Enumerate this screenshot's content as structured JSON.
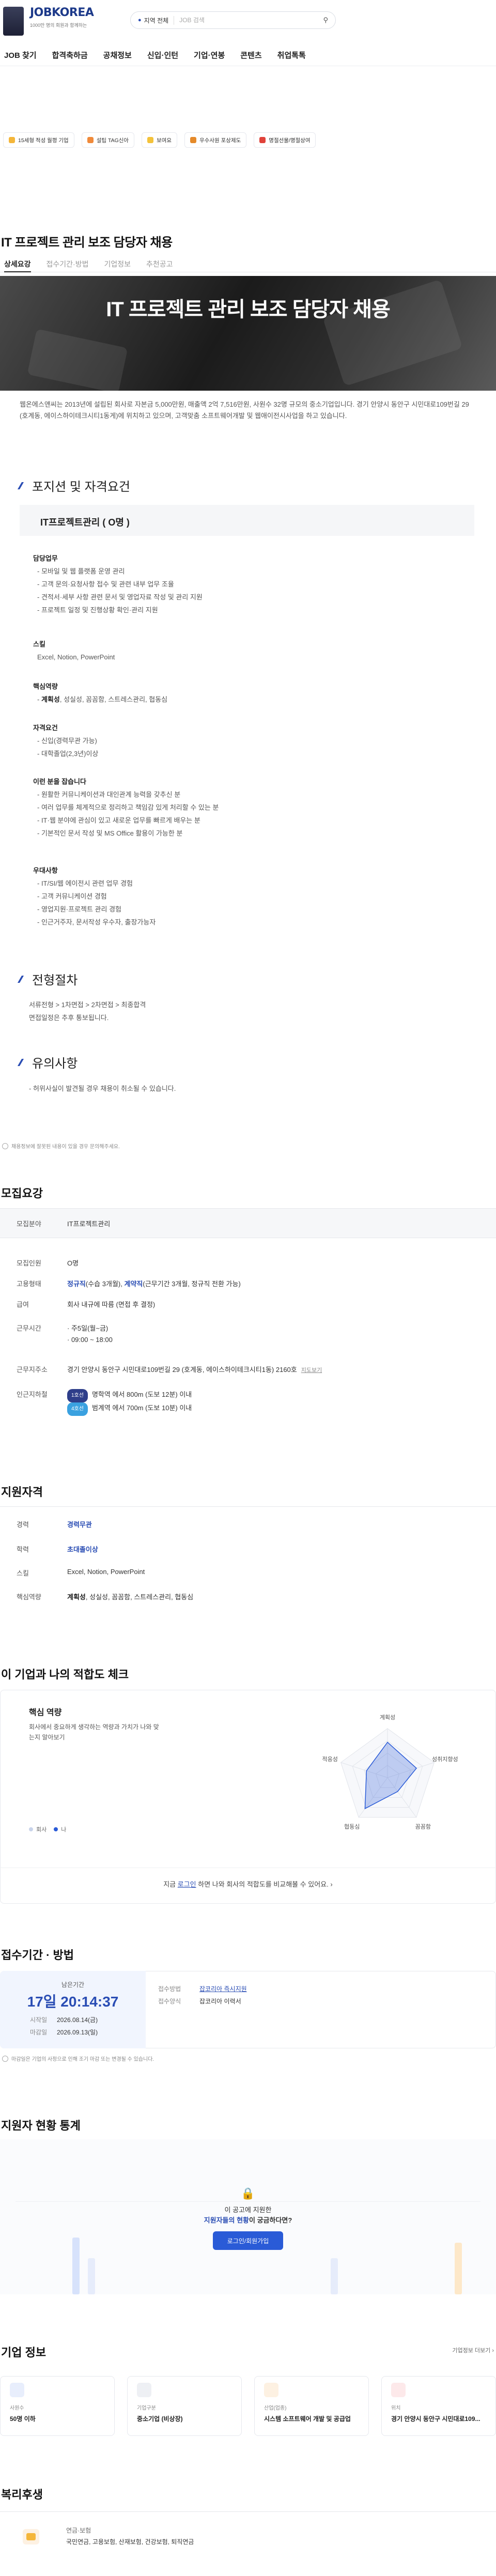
{
  "header": {
    "logo": "JOBKOREA",
    "logo_sub": "1000만 명의 회원과 함께하는",
    "region": "지역 전체",
    "search_placeholder": "JOB 검색"
  },
  "gnb": [
    "JOB 찾기",
    "합격축하금",
    "공채정보",
    "신입·인턴",
    "기업·연봉",
    "콘텐츠",
    "취업톡톡"
  ],
  "quick_links": [
    {
      "label": "15세형 적성 월평 기업",
      "color": "#f4b63a"
    },
    {
      "label": "설팁 TAG신아",
      "color": "#f08a3a"
    },
    {
      "label": "보여요",
      "color": "#f4c23a"
    },
    {
      "label": "우수사원 포상제도",
      "color": "#e58a2a"
    },
    {
      "label": "명절선물/명절상여",
      "color": "#e0423a"
    }
  ],
  "job": {
    "title": "IT 프로젝트 관리 보조 담당자 채용",
    "tabs": [
      "상세요강",
      "접수기간·방법",
      "기업정보",
      "추천공고"
    ],
    "hero_title": "IT 프로젝트 관리 보조 담당자 채용",
    "intro": "웹온에스앤씨는 2013년에 설립된 회사로 자본금 5,000만원, 매출액 2억 7,516만원, 사원수 32명 규모의 중소기업입니다. 경기 안양시 동안구 시민대로109번길 29 (호계동, 에이스하이테크시티1동게)에 위치하고 있으며, 고객맞춤 소프트웨어개발 및 웹애이전시사업을 하고 있습니다."
  },
  "detail": {
    "sec_positions": "포지션 및 자격요건",
    "position_name": "IT프로젝트관리 ( O명 )",
    "duty_title": "담당업무",
    "duties": [
      "- 모바일 및 웹 플랫폼 운영 관리",
      "- 고객 문의·요청사항 접수 및 관련 내부 업무 조율",
      "- 견적서·세부 사항 관련 문서 및 영업자료 작성 및 관리 지원",
      "- 프로젝트 일정 및 진행상황 확인·관리 지원"
    ],
    "skill_title": "스킬",
    "skills": "Excel, Notion, PowerPoint",
    "core_title": "핵심역량",
    "core_bold": "계획성",
    "core_rest": ", 성실성, 꼼꼼함, 스트레스관리, 협동심",
    "qual_title": "자격요건",
    "quals": [
      "- 신입(경력무관 가능)",
      "- 대학졸업(2,3년)이상"
    ],
    "pref_title": "이런 분을 잡습니다",
    "prefs": [
      "- 원활한 커뮤니케이션과 대인관계 능력을 갖추신 분",
      "- 여러 업무를 체계적으로 정리하고 책임감 있게 처리할 수 있는 분",
      "- IT·웹 분야에 관심이 있고 새로운 업무를 빠르게 배우는 분",
      "- 기본적인 문서 작성 및 MS Office 활용이 가능한 분"
    ],
    "plus_title": "우대사항",
    "plus": [
      "- IT/SI/웹 에이전시 관련 업무 경험",
      "- 고객 커뮤니케이션 경험",
      "- 영업지원·프로젝트 관리 경험",
      "- 인근거주자, 문서작성 우수자, 출장가능자"
    ],
    "sec_process": "전형절차",
    "process": "서류전형 > 1차면접 > 2차면접 > 최종합격",
    "process_note": "면접일정은 추후 통보됩니다.",
    "sec_notice": "유의사항",
    "notice": "- 허위사실이 발견될 경우 채용이 취소될 수 있습니다.",
    "disclaimer": "채용정보에 잘못된 내용이 있을 경우 문의해주세요."
  },
  "recruit": {
    "title": "모집요강",
    "rows": [
      {
        "label": "모집분야",
        "value": "IT프로젝트관리"
      },
      {
        "label": "모집인원",
        "value": "O명"
      },
      {
        "label": "고용형태",
        "blue1": "정규직",
        "mid1": "(수습 3개월), ",
        "blue2": "계약직",
        "mid2": "(근무기간 3개월, 정규직 전환 가능)"
      },
      {
        "label": "급여",
        "value": "회사 내규에 따름 (면접 후 결정)"
      },
      {
        "label": "근무시간",
        "value": "· 주5일(월~금)",
        "value2": "· 09:00 ~ 18:00"
      },
      {
        "label": "근무지주소",
        "value": "경기 안양시 동안구 시민대로109번길 29 (호계동, 에이스하이테크시티1동) 2160호",
        "link": "지도보기"
      },
      {
        "label": "인근지하철",
        "pill1": "1호선",
        "sub1": "명학역 에서 800m (도보 12분) 이내",
        "pill2": "4호선",
        "sub2": "범계역 에서 700m (도보 10분) 이내"
      }
    ]
  },
  "qualify": {
    "title": "지원자격",
    "rows": [
      {
        "label": "경력",
        "value": "경력무관",
        "blue": true
      },
      {
        "label": "학력",
        "value": "초대졸이상",
        "blue": true
      },
      {
        "label": "스킬",
        "value": "Excel, Notion, PowerPoint"
      },
      {
        "label": "핵심역량",
        "bold": "계획성",
        "rest": ", 성실성, 꼼꼼함, 스트레스관리, 협동심"
      }
    ]
  },
  "fit": {
    "title": "이 기업과 나의 적합도 체크",
    "sub_title": "핵심 역량",
    "sub_desc": "회사에서 중요하게 생각하는 역량과 가치가 나와 맞는지 알아보기",
    "legend_company": "회사",
    "legend_me": "나",
    "axes": [
      "계획성",
      "성취지향성",
      "꼼꼼함",
      "협동심",
      "적응성"
    ],
    "cta_pre": "지금 ",
    "cta_link": "로그인",
    "cta_post": " 하면 나와 회사의 적합도를 비교해볼 수 있어요."
  },
  "apply": {
    "title": "접수기간 · 방법",
    "remain_label": "남은기간",
    "remain": "17일 20:14:37",
    "start_label": "시작일",
    "start": "2026.08.14(금)",
    "end_label": "마감일",
    "end": "2026.09.13(일)",
    "method_label": "접수방법",
    "method": "잡코리아 즉시지원",
    "form_label": "접수양식",
    "form": "잡코리아 이력서",
    "note": "마감일은 기업의 사정으로 인해 조기 마감 또는 변경될 수 있습니다."
  },
  "stats": {
    "title": "지원자 현황 통계",
    "overlay_line1": "이 공고에 지원한",
    "overlay_blue": "지원자들의 현황",
    "overlay_line2": "이 궁금하다면?",
    "login_button": "로그인/회원가입"
  },
  "company": {
    "title": "기업 정보",
    "more": "기업정보 더보기",
    "cards": [
      {
        "k": "사원수",
        "v": "50명 이하",
        "color": "#e8eefc"
      },
      {
        "k": "기업구분",
        "v": "중소기업 (비상장)",
        "color": "#eef0f4"
      },
      {
        "k": "산업(업종)",
        "v": "시스템 소프트웨어 개발 및 공급업",
        "color": "#fdf1e2"
      },
      {
        "k": "위치",
        "v": "경기 안양시 동안구 시민대로109...",
        "color": "#fde9ea"
      }
    ]
  },
  "welfare": {
    "title": "복리후생",
    "cat": "연금·보험",
    "items": "국민연금, 고용보험, 산재보험, 건강보험, 퇴직연금"
  }
}
